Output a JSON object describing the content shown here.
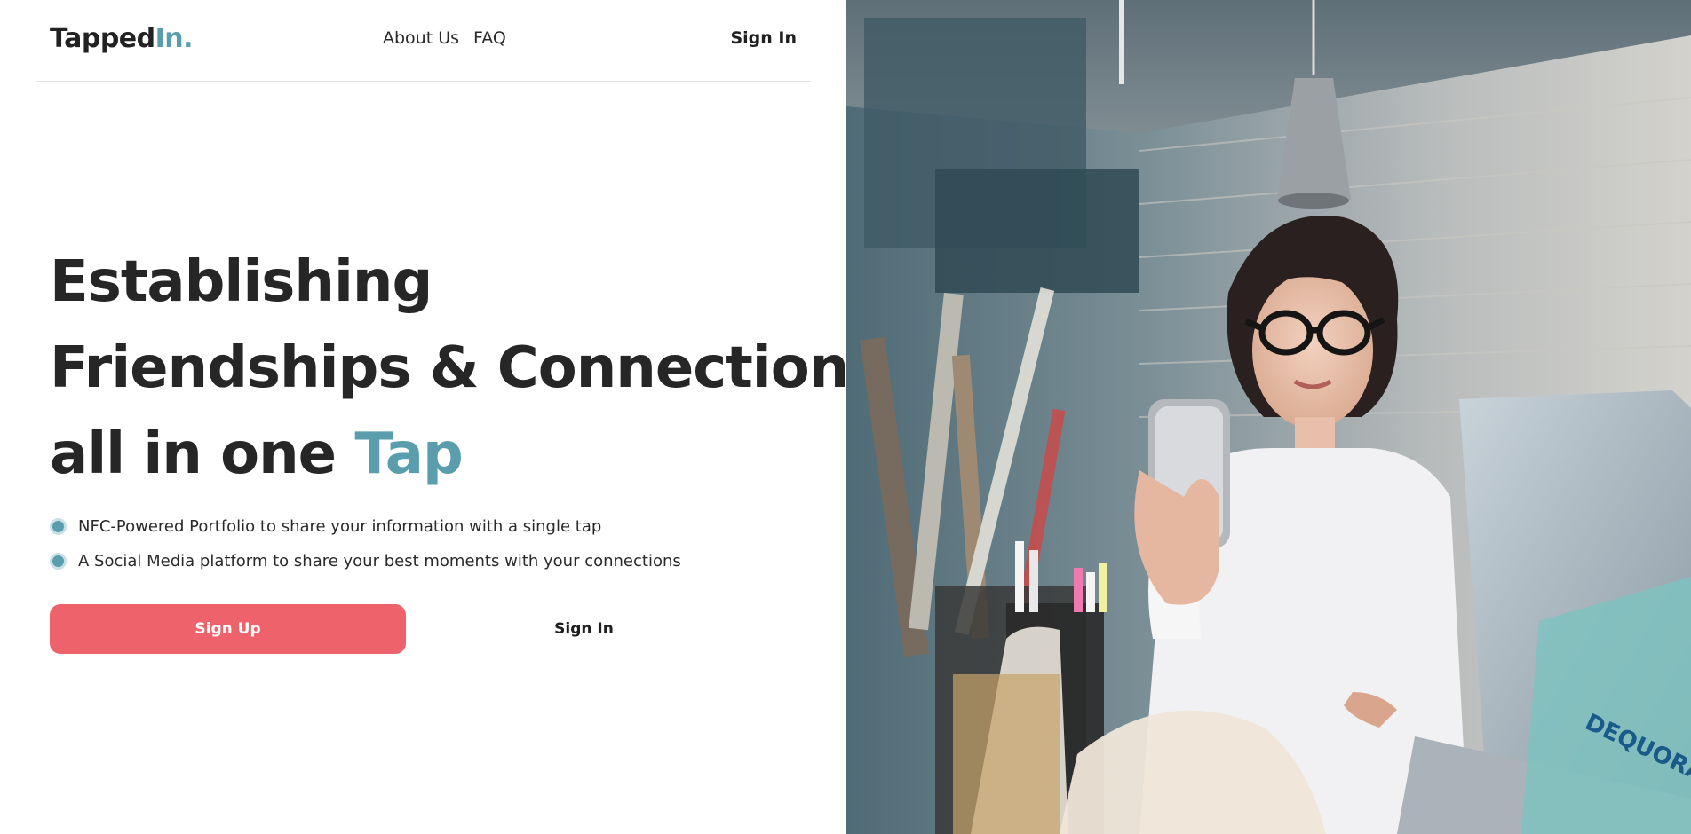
{
  "brand": {
    "name_main": "Tapped",
    "name_accent": "In."
  },
  "nav": {
    "links": [
      {
        "label": "About Us"
      },
      {
        "label": "FAQ"
      }
    ],
    "signin": "Sign In"
  },
  "hero": {
    "line1": "Establishing",
    "line2": "Friendships & Connections,",
    "line3_prefix": "all in one ",
    "line3_accent": "Tap"
  },
  "features": [
    {
      "text": "NFC-Powered Portfolio to share your information with a single tap",
      "icon": "bullet-dot-icon"
    },
    {
      "text": "A Social Media platform to share your best moments with your connections",
      "icon": "bullet-dot-icon"
    }
  ],
  "cta": {
    "primary": "Sign Up",
    "secondary": "Sign In"
  },
  "photo": {
    "description_icon": "hero-photo"
  },
  "colors": {
    "accent": "#5a9ead",
    "primary_button": "#ee636b",
    "text": "#222222"
  }
}
